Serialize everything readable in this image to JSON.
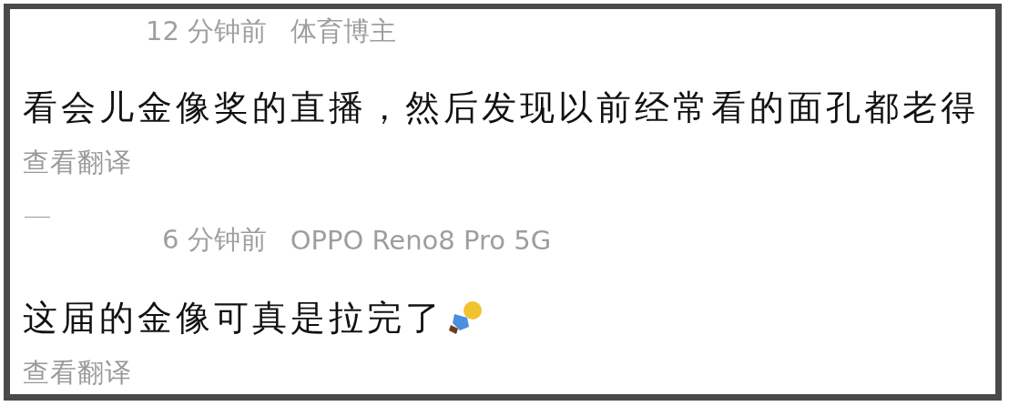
{
  "comments": [
    {
      "time": "12 分钟前",
      "source": "体育博主",
      "text": "看会儿金像奖的直播，然后发现以前经常看的面孔都老得",
      "translate": "查看翻译",
      "emoji": false
    },
    {
      "time": "6 分钟前",
      "source": "OPPO Reno8 Pro 5G",
      "text": "这届的金像可真是拉完了",
      "translate": "查看翻译",
      "emoji": true
    }
  ]
}
